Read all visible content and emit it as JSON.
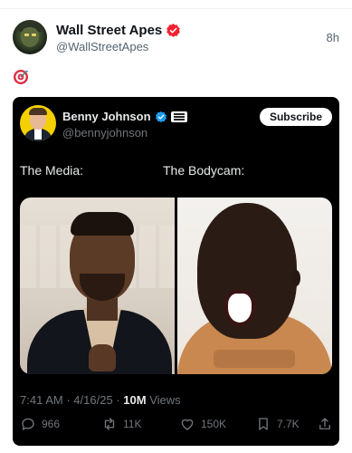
{
  "post": {
    "author_name": "Wall Street Apes",
    "author_handle": "@WallStreetApes",
    "time_ago": "8h",
    "emoji": "🎯"
  },
  "quoted_post": {
    "author_name": "Benny Johnson",
    "author_handle": "@bennyjohnson",
    "subscribe_label": "Subscribe",
    "caption_left": "The Media:",
    "caption_right": "The Bodycam:",
    "meta": {
      "time": "7:41 AM",
      "separator": "·",
      "date": "4/16/25",
      "views_count": "10M",
      "views_label": "Views"
    },
    "actions": {
      "replies": "966",
      "reposts": "11K",
      "likes": "150K",
      "bookmarks": "7.7K"
    }
  },
  "colors": {
    "verified_red": "#f4212e",
    "verified_blue": "#1d9bf0",
    "card_bg": "#000000"
  },
  "icons": [
    "verified-badge-icon",
    "target-emoji-icon",
    "affiliate-badge-icon",
    "reply-icon",
    "repost-icon",
    "like-icon",
    "bookmark-icon",
    "share-icon"
  ]
}
